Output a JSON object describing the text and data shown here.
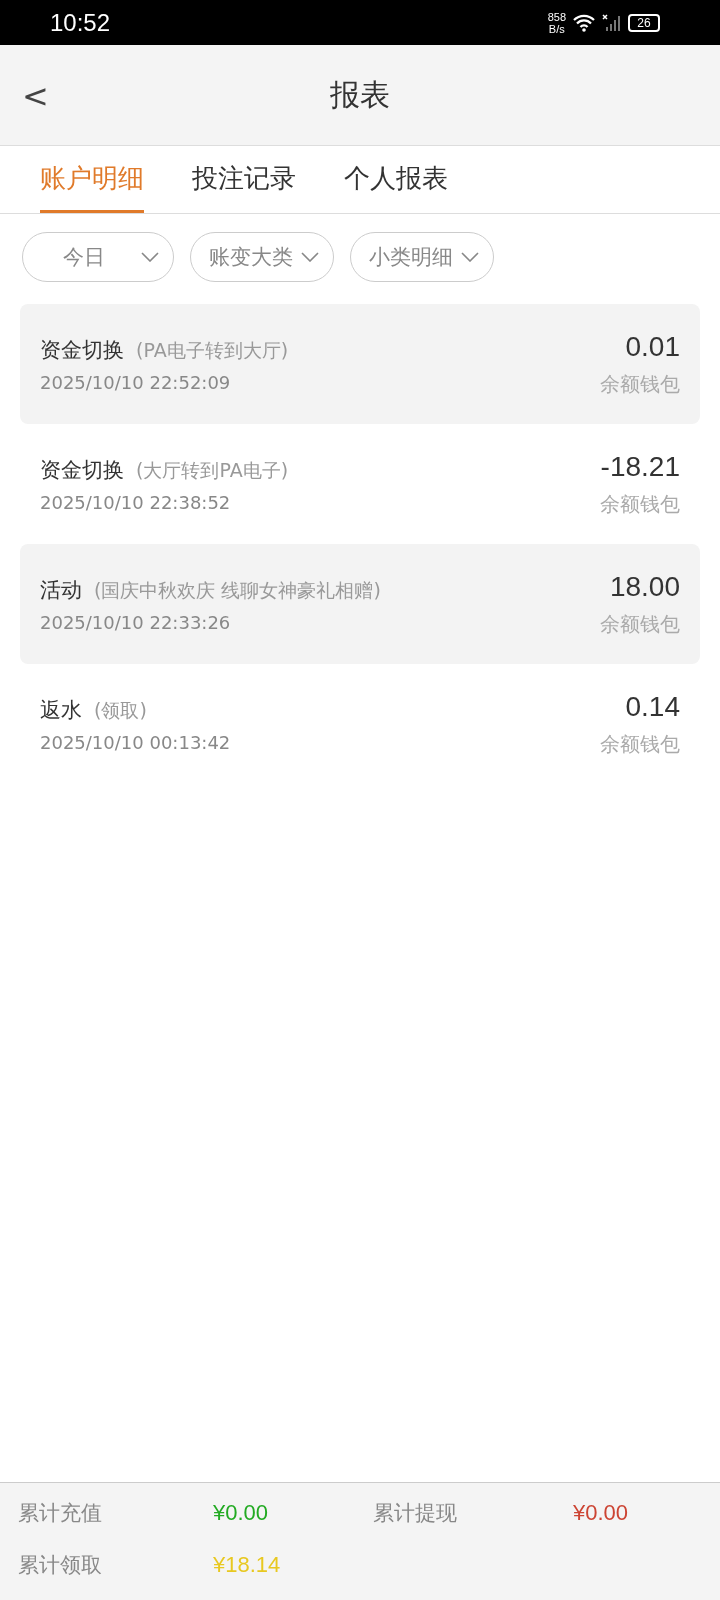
{
  "status_bar": {
    "time": "10:52",
    "net_speed": [
      "858",
      "B/s"
    ],
    "battery": "26"
  },
  "header": {
    "back": "<",
    "title": "报表"
  },
  "tabs": [
    {
      "label": "账户明细",
      "selected": true
    },
    {
      "label": "投注记录",
      "selected": false
    },
    {
      "label": "个人报表",
      "selected": false
    }
  ],
  "filters": [
    {
      "label": "今日"
    },
    {
      "label": "账变大类"
    },
    {
      "label": "小类明细"
    }
  ],
  "records": [
    {
      "type": "资金切换",
      "detail": "(PA电子转到大厅)",
      "time": "2025/10/10 22:52:09",
      "amount": "0.01",
      "wallet": "余额钱包"
    },
    {
      "type": "资金切换",
      "detail": "(大厅转到PA电子)",
      "time": "2025/10/10 22:38:52",
      "amount": "-18.21",
      "wallet": "余额钱包"
    },
    {
      "type": "活动",
      "detail": "(国庆中秋欢庆 线聊女神豪礼相赠)",
      "time": "2025/10/10 22:33:26",
      "amount": "18.00",
      "wallet": "余额钱包"
    },
    {
      "type": "返水",
      "detail": "(领取)",
      "time": "2025/10/10 00:13:42",
      "amount": "0.14",
      "wallet": "余额钱包"
    }
  ],
  "summary": [
    {
      "label": "累计充值",
      "value": "¥0.00",
      "color": "#22aa22"
    },
    {
      "label": "累计提现",
      "value": "¥0.00",
      "color": "#cc4433"
    },
    {
      "label": "累计领取",
      "value": "¥18.14",
      "color": "#e8c820"
    }
  ]
}
